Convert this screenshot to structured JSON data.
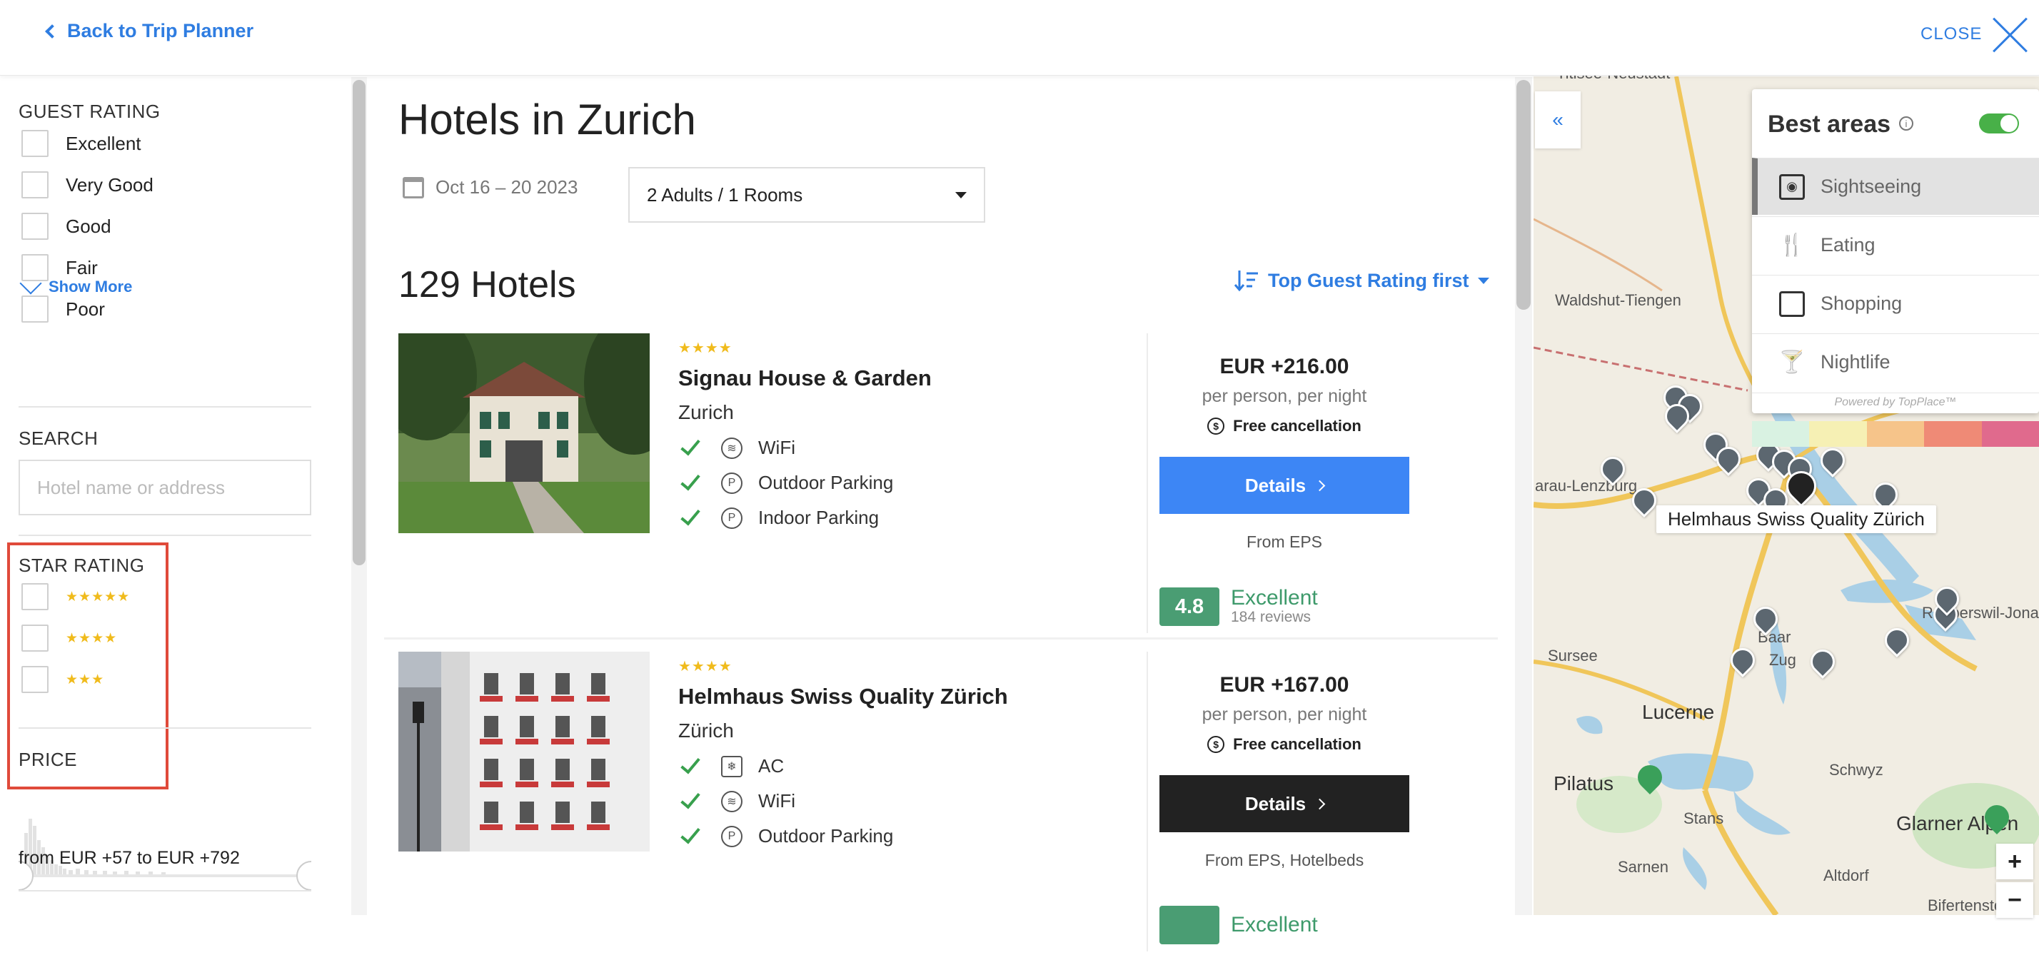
{
  "header": {
    "back_label": "Back to Trip Planner",
    "close_label": "CLOSE"
  },
  "filters": {
    "guest_rating": {
      "title": "GUEST RATING",
      "options": [
        "Excellent",
        "Very Good",
        "Good",
        "Fair",
        "Poor"
      ],
      "show_more": "Show More"
    },
    "search": {
      "title": "SEARCH",
      "placeholder": "Hotel name or address"
    },
    "star_rating": {
      "title": "STAR RATING",
      "options": [
        "★★★★★",
        "★★★★",
        "★★★"
      ]
    },
    "price": {
      "title": "PRICE",
      "range_text": "from EUR +57 to EUR +792"
    }
  },
  "main": {
    "title": "Hotels in Zurich",
    "dates": "Oct 16 – 20 2023",
    "guests": "2 Adults / 1 Rooms",
    "count": "129 Hotels",
    "sort_label": "Top Guest Rating first",
    "hotels": [
      {
        "stars": "★★★★",
        "name": "Signau House & Garden",
        "city": "Zurich",
        "amenities": [
          "WiFi",
          "Outdoor Parking",
          "Indoor Parking"
        ],
        "price": "EUR +216.00",
        "per": "per person, per night",
        "cancellation": "Free cancellation",
        "details_label": "Details",
        "from": "From EPS",
        "rating": "4.8",
        "rating_word": "Excellent",
        "reviews": "184 reviews",
        "button_color": "#3d86f5"
      },
      {
        "stars": "★★★★",
        "name": "Helmhaus Swiss Quality Zürich",
        "city": "Zürich",
        "amenities": [
          "AC",
          "WiFi",
          "Outdoor Parking"
        ],
        "price": "EUR +167.00",
        "per": "per person, per night",
        "cancellation": "Free cancellation",
        "details_label": "Details",
        "from": "From EPS, Hotelbeds",
        "rating_word": "Excellent",
        "button_color": "#222222"
      }
    ]
  },
  "map": {
    "collapse_label": "«",
    "best_areas": {
      "title": "Best areas",
      "items": [
        "Sightseeing",
        "Eating",
        "Shopping",
        "Nightlife"
      ],
      "powered": "Powered by TopPlace™",
      "legend_colors": [
        "#d9f2e2",
        "#f6f0b4",
        "#f6c48a",
        "#ef8a76",
        "#e06a8d"
      ]
    },
    "hotel_label": "Helmhaus Swiss Quality Zürich",
    "places": {
      "titisee": "Titisee-Neustadt",
      "waldshut": "Waldshut-Tiengen",
      "aarau": "arau-Lenzburg",
      "rapperswil": "Rapperswil-Jona",
      "baar": "Baar",
      "zug": "Zug",
      "sursee": "Sursee",
      "lucerne": "Lucerne",
      "schwyz": "Schwyz",
      "pilatus": "Pilatus",
      "stans": "Stans",
      "glarner": "Glarner Alpen",
      "sarnen": "Sarnen",
      "altdorf": "Altdorf",
      "bifertenstock": "Bifertenstock"
    },
    "zoom_in": "+",
    "zoom_out": "−"
  }
}
